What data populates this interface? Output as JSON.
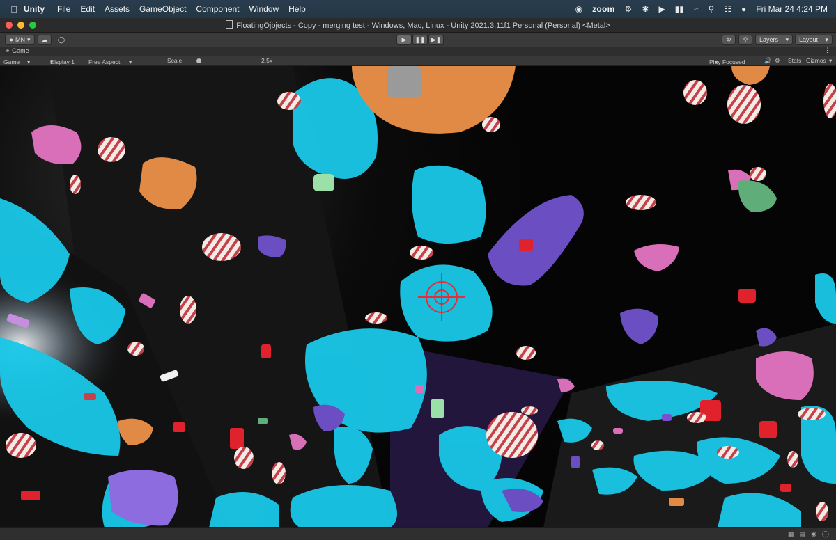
{
  "menubar": {
    "app": "Unity",
    "items": [
      "File",
      "Edit",
      "Assets",
      "GameObject",
      "Component",
      "Window",
      "Help"
    ],
    "status_zoom": "zoom",
    "clock": "Fri Mar 24  4:24 PM"
  },
  "window": {
    "title": "FloatingOjbjects - Copy - merging test - Windows, Mac, Linux - Unity 2021.3.11f1 Personal (Personal) <Metal>"
  },
  "toolbar": {
    "account": "MN",
    "layers": "Layers",
    "layout": "Layout"
  },
  "game_view": {
    "tab": "Game",
    "mode": "Game",
    "display": "Display 1",
    "aspect": "Free Aspect",
    "scale_label": "Scale",
    "scale_value": "2.5x",
    "play_focused": "Play Focused",
    "stats": "Stats",
    "gizmos": "Gizmos"
  },
  "colors": {
    "menubar": "#243746",
    "cyan_candy": "#19c8e8",
    "orange_candy": "#e08a45",
    "purple_candy": "#6b4fc2",
    "pink_candy": "#d86fb8",
    "crosshair": "#e0303a"
  }
}
